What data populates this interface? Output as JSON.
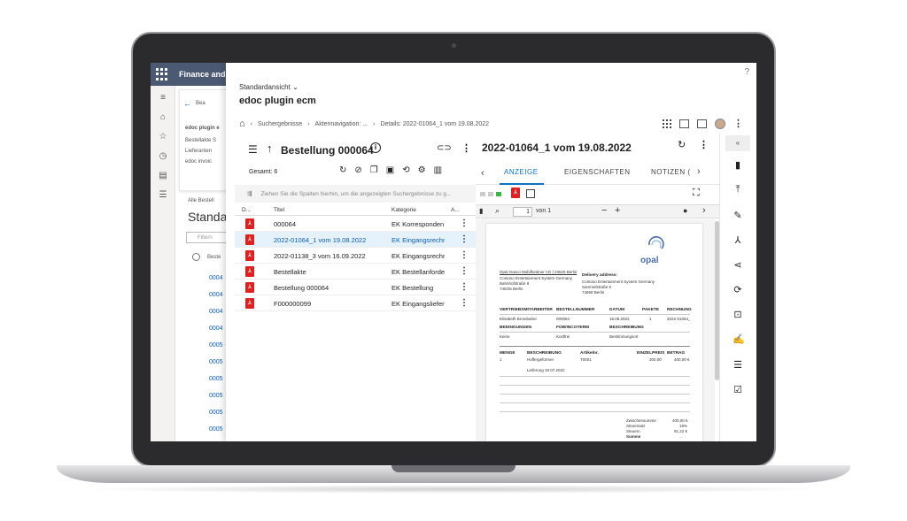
{
  "backapp": {
    "title": "Finance and",
    "back_link": "Bea",
    "card_title": "edoc plugin e",
    "card_lines": [
      "Bestellakte S",
      "Lieferanten",
      "edoc invoic"
    ],
    "section_label": "Alle Bestell",
    "heading": "Standa",
    "filter_placeholder": "Filtern",
    "col_label": "Beste",
    "rows": [
      "0004",
      "0004",
      "0004",
      "0004",
      "0005",
      "0005",
      "0005",
      "0005",
      "0005",
      "0005"
    ]
  },
  "header": {
    "help": "?",
    "view_selector": "Standardansicht",
    "app_title": "edoc plugin ecm",
    "breadcrumb": [
      "Suchergebnisse",
      "Aktennavigation: ...",
      "Details: 2022-01064_1 vom 19.08.2022"
    ]
  },
  "list": {
    "title": "Bestellung 000064",
    "total": "Gesamt: 6",
    "group_hint": "Ziehen Sie die Spalten hierhin, um die angezeigten Suchergebnisse zu g...",
    "columns": [
      "D...",
      "Titel",
      "Kategorie",
      "A..."
    ],
    "rows": [
      {
        "title": "000064",
        "category": "EK Korresponden"
      },
      {
        "title": "2022-01064_1 vom 19.08.2022",
        "category": "EK Eingangsrechn"
      },
      {
        "title": "2022-01138_3 vom 16.09.2022",
        "category": "EK Eingangsrechn"
      },
      {
        "title": "Bestellakte",
        "category": "EK Bestellanforde"
      },
      {
        "title": "Bestellung 000064",
        "category": "EK Bestellung"
      },
      {
        "title": "F000000099",
        "category": "EK Eingangsliefer"
      }
    ]
  },
  "preview": {
    "title": "2022-01064_1 vom 19.08.2022",
    "tabs": [
      "ANZEIGE",
      "EIGENSCHAFTEN",
      "NOTIZEN ("
    ],
    "page_value": "1",
    "page_of": "von 1",
    "doc": {
      "logo_text": "opal",
      "sender_line": "Opal Gasco Mobilfunkner AG | 23525 Berlin",
      "address": [
        "Contoso Entertainment System Germany",
        "Bahnhofstraße 8",
        "745/26 Berlin"
      ],
      "delivery_label": "Delivery address:",
      "delivery": [
        "Contoso Entertainment System Germany",
        "Sammelstraße 6",
        "74658 Berlin"
      ],
      "head1": [
        "VERTRIEBSMITARBEITER",
        "BESTELLNUMMER",
        "DATUM",
        "PAKETE",
        "RECHNUNG"
      ],
      "row1": [
        "Elisabeth Brombaher",
        "000064",
        "19.08.2022",
        "1",
        "2022-01064_1"
      ],
      "head2": [
        "BEDINGUNGEN",
        "FOB/INCOTERM",
        "BESCHREIBUNG"
      ],
      "row2": [
        "Keine",
        "Kostfrei",
        "Bestimmungsort"
      ],
      "head3": [
        "MENGE",
        "BESCHREIBUNG",
        "Artikelnr.",
        "EINZELPREIS",
        "BETRAG"
      ],
      "row3": [
        "1",
        "Hoffergeformer",
        "T0001",
        "300,00",
        "400,00 €"
      ],
      "delivery_date": "Lieferung 19.07.2022",
      "totals_labels": [
        "Zwischensumme",
        "Steuersatz",
        "Steuern",
        "Summe"
      ],
      "totals_values": [
        "400,00 €",
        "19%",
        "91,22 €",
        "..."
      ]
    }
  },
  "colors": {
    "accent": "#0b73c4",
    "pdf": "#e02020",
    "selected_row": "#e5f1fb",
    "appbar": "#4b5a72"
  }
}
